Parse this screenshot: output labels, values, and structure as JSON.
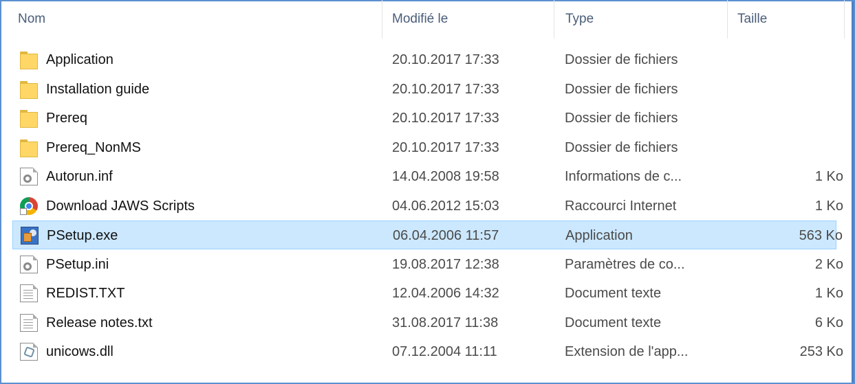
{
  "columns": {
    "name": "Nom",
    "modified": "Modifié le",
    "type": "Type",
    "size": "Taille"
  },
  "files": [
    {
      "name": "Application",
      "modified": "20.10.2017 17:33",
      "type": "Dossier de fichiers",
      "size": "",
      "icon": "folder-icon"
    },
    {
      "name": "Installation guide",
      "modified": "20.10.2017 17:33",
      "type": "Dossier de fichiers",
      "size": "",
      "icon": "folder-icon"
    },
    {
      "name": "Prereq",
      "modified": "20.10.2017 17:33",
      "type": "Dossier de fichiers",
      "size": "",
      "icon": "folder-icon"
    },
    {
      "name": "Prereq_NonMS",
      "modified": "20.10.2017 17:33",
      "type": "Dossier de fichiers",
      "size": "",
      "icon": "folder-icon"
    },
    {
      "name": "Autorun.inf",
      "modified": "14.04.2008 19:58",
      "type": "Informations de c...",
      "size": "1 Ko",
      "icon": "settings-file-icon"
    },
    {
      "name": "Download JAWS Scripts",
      "modified": "04.06.2012 15:03",
      "type": "Raccourci Internet",
      "size": "1 Ko",
      "icon": "internet-shortcut-icon"
    },
    {
      "name": "PSetup.exe",
      "modified": "06.04.2006 11:57",
      "type": "Application",
      "size": "563 Ko",
      "icon": "setup-exe-icon",
      "selected": true
    },
    {
      "name": "PSetup.ini",
      "modified": "19.08.2017 12:38",
      "type": "Paramètres de co...",
      "size": "2 Ko",
      "icon": "settings-file-icon"
    },
    {
      "name": "REDIST.TXT",
      "modified": "12.04.2006 14:32",
      "type": "Document texte",
      "size": "1 Ko",
      "icon": "text-file-icon"
    },
    {
      "name": "Release notes.txt",
      "modified": "31.08.2017 11:38",
      "type": "Document texte",
      "size": "6 Ko",
      "icon": "text-file-icon"
    },
    {
      "name": "unicows.dll",
      "modified": "07.12.2004 11:11",
      "type": "Extension de l'app...",
      "size": "253 Ko",
      "icon": "dll-file-icon"
    }
  ],
  "colors": {
    "selection_bg": "#cce8ff",
    "selection_border": "#99d1ff",
    "window_border": "#5b8fd0"
  }
}
